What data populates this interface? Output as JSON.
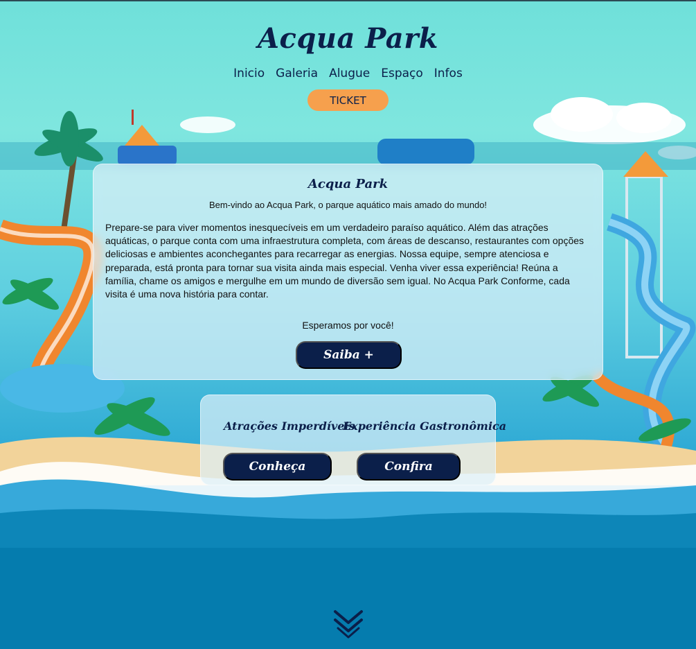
{
  "header": {
    "brand": "Acqua Park",
    "nav": [
      "Inicio",
      "Galeria",
      "Alugue",
      "Espaço",
      "Infos"
    ],
    "ticket_label": "TICKET"
  },
  "welcome_card": {
    "title": "Acqua Park",
    "subtitle": "Bem-vindo ao Acqua Park, o parque aquático mais amado do mundo!",
    "body": "Prepare-se para viver momentos inesquecíveis em um verdadeiro paraíso aquático. Além das atrações aquáticas, o parque conta com uma infraestrutura completa, com áreas de descanso, restaurantes com opções deliciosas e ambientes aconchegantes para recarregar as energias. Nossa equipe, sempre atenciosa e preparada, está pronta para tornar sua visita ainda mais especial. Venha viver essa experiência! Reúna a família, chame os amigos e mergulhe em um mundo de diversão sem igual. No Acqua Park Conforme, cada visita é uma nova história para contar.",
    "closing": "Esperamos por você!",
    "button_label": "Saiba +"
  },
  "features_card": {
    "items": [
      {
        "title": "Atrações Imperdíveis",
        "button_label": "Conheça"
      },
      {
        "title": "Experiência Gastronômica",
        "button_label": "Confira"
      }
    ]
  },
  "icons": {
    "scroll_down": "double-chevron-down-icon"
  },
  "colors": {
    "accent": "#f6a04d",
    "primary_dark": "#0b1f4a",
    "sky": "#7fe6df",
    "ocean": "#057cae"
  }
}
